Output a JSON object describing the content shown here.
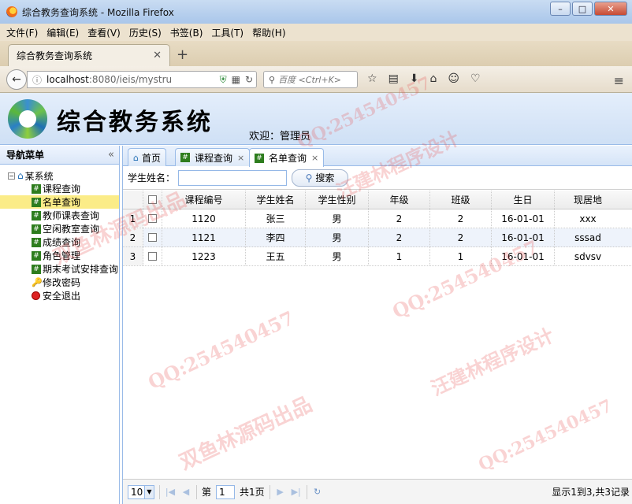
{
  "browser": {
    "window_title": "综合教务查询系统 - Mozilla Firefox",
    "menu": [
      "文件(F)",
      "编辑(E)",
      "查看(V)",
      "历史(S)",
      "书签(B)",
      "工具(T)",
      "帮助(H)"
    ],
    "tab_title": "综合教务查询系统",
    "url_host": "localhost",
    "url_path": ":8080/ieis/mystru",
    "search_placeholder": "百度 <Ctrl+K>"
  },
  "header": {
    "title": "综合教务系统",
    "welcome": "欢迎：管理员"
  },
  "nav": {
    "heading": "导航菜单",
    "root": "某系统",
    "items": [
      {
        "label": "课程查询",
        "icon": "grid-icon"
      },
      {
        "label": "名单查询",
        "icon": "grid-icon",
        "selected": true
      },
      {
        "label": "教师课表查询",
        "icon": "grid-icon"
      },
      {
        "label": "空闲教室查询",
        "icon": "grid-icon"
      },
      {
        "label": "成绩查询",
        "icon": "grid-icon"
      },
      {
        "label": "角色管理",
        "icon": "grid-icon"
      },
      {
        "label": "期末考试安排查询",
        "icon": "grid-icon"
      },
      {
        "label": "修改密码",
        "icon": "key-icon"
      },
      {
        "label": "安全退出",
        "icon": "exit-icon"
      }
    ]
  },
  "tabs": [
    {
      "label": "首页",
      "closable": false
    },
    {
      "label": "课程查询",
      "closable": true
    },
    {
      "label": "名单查询",
      "closable": true,
      "active": true
    }
  ],
  "toolbar": {
    "name_label": "学生姓名：",
    "name_value": "",
    "search_label": "搜索"
  },
  "table": {
    "headers": [
      "课程编号",
      "学生姓名",
      "学生性别",
      "年级",
      "班级",
      "生日",
      "现居地"
    ],
    "rows": [
      {
        "num": "1",
        "code": "1120",
        "name": "张三",
        "sex": "男",
        "grade": "2",
        "class": "2",
        "birthday": "16-01-01",
        "address": "xxx"
      },
      {
        "num": "2",
        "code": "1121",
        "name": "李四",
        "sex": "男",
        "grade": "2",
        "class": "2",
        "birthday": "16-01-01",
        "address": "sssad"
      },
      {
        "num": "3",
        "code": "1223",
        "name": "王五",
        "sex": "男",
        "grade": "1",
        "class": "1",
        "birthday": "16-01-01",
        "address": "sdvsv"
      }
    ]
  },
  "pager": {
    "page_size": "10",
    "page_prefix": "第",
    "current_page": "1",
    "total_pages": "共1页",
    "info": "显示1到3,共3记录"
  },
  "watermarks": [
    "QQ:254540457",
    "汪建林程序设计",
    "双鱼林源码出品"
  ]
}
